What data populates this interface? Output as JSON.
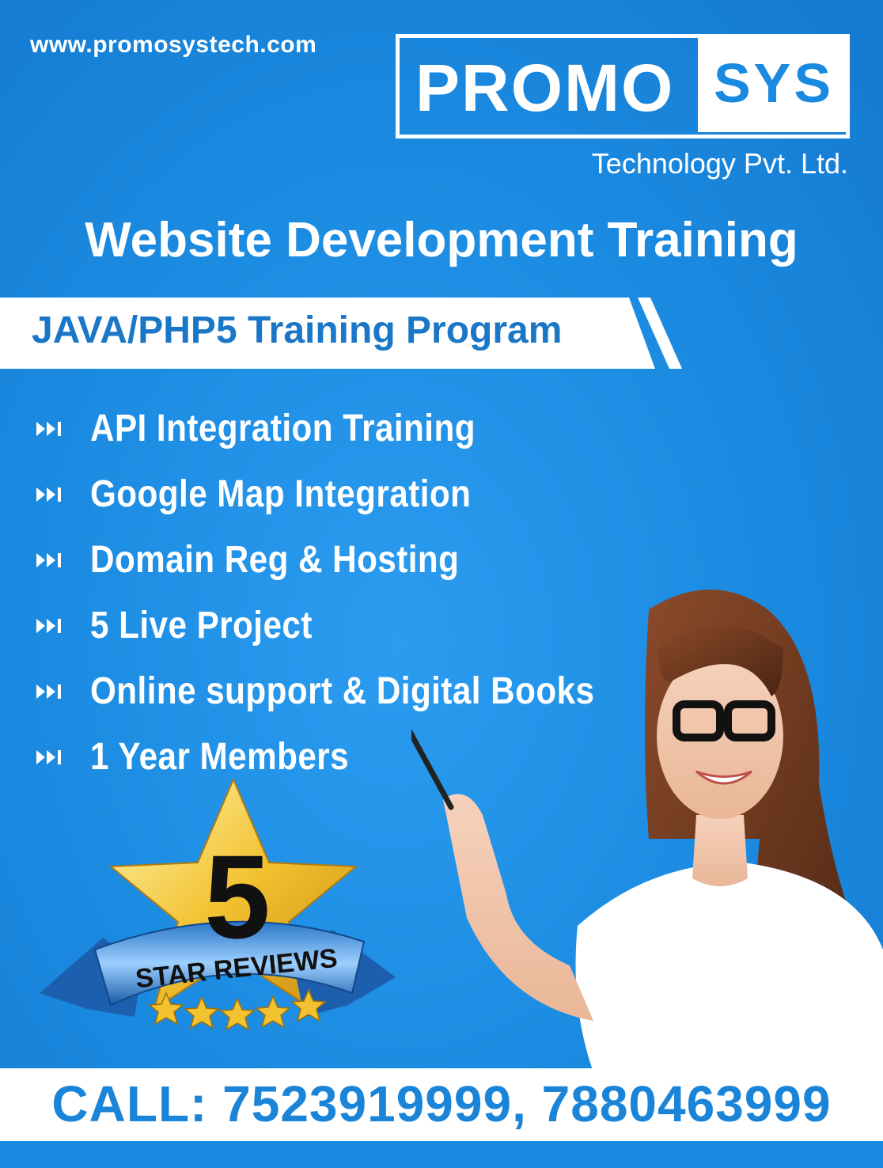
{
  "website": "www.promosystech.com",
  "logo": {
    "part1": "PROMO",
    "part2": "SYS",
    "tagline": "Technology Pvt. Ltd."
  },
  "headline": "Website Development Training",
  "program": "JAVA/PHP5 Training Program",
  "features": [
    "API Integration Training",
    "Google Map Integration",
    "Domain Reg & Hosting",
    "5 Live Project",
    "Online support & Digital Books",
    "1 Year Members"
  ],
  "badge": {
    "number": "5",
    "text": "STAR REVIEWS"
  },
  "contact": "CALL: 7523919999, 7880463999",
  "colors": {
    "background": "#1a8ae0",
    "accent": "#1a76c6",
    "white": "#ffffff",
    "gold": "#f2c230"
  }
}
